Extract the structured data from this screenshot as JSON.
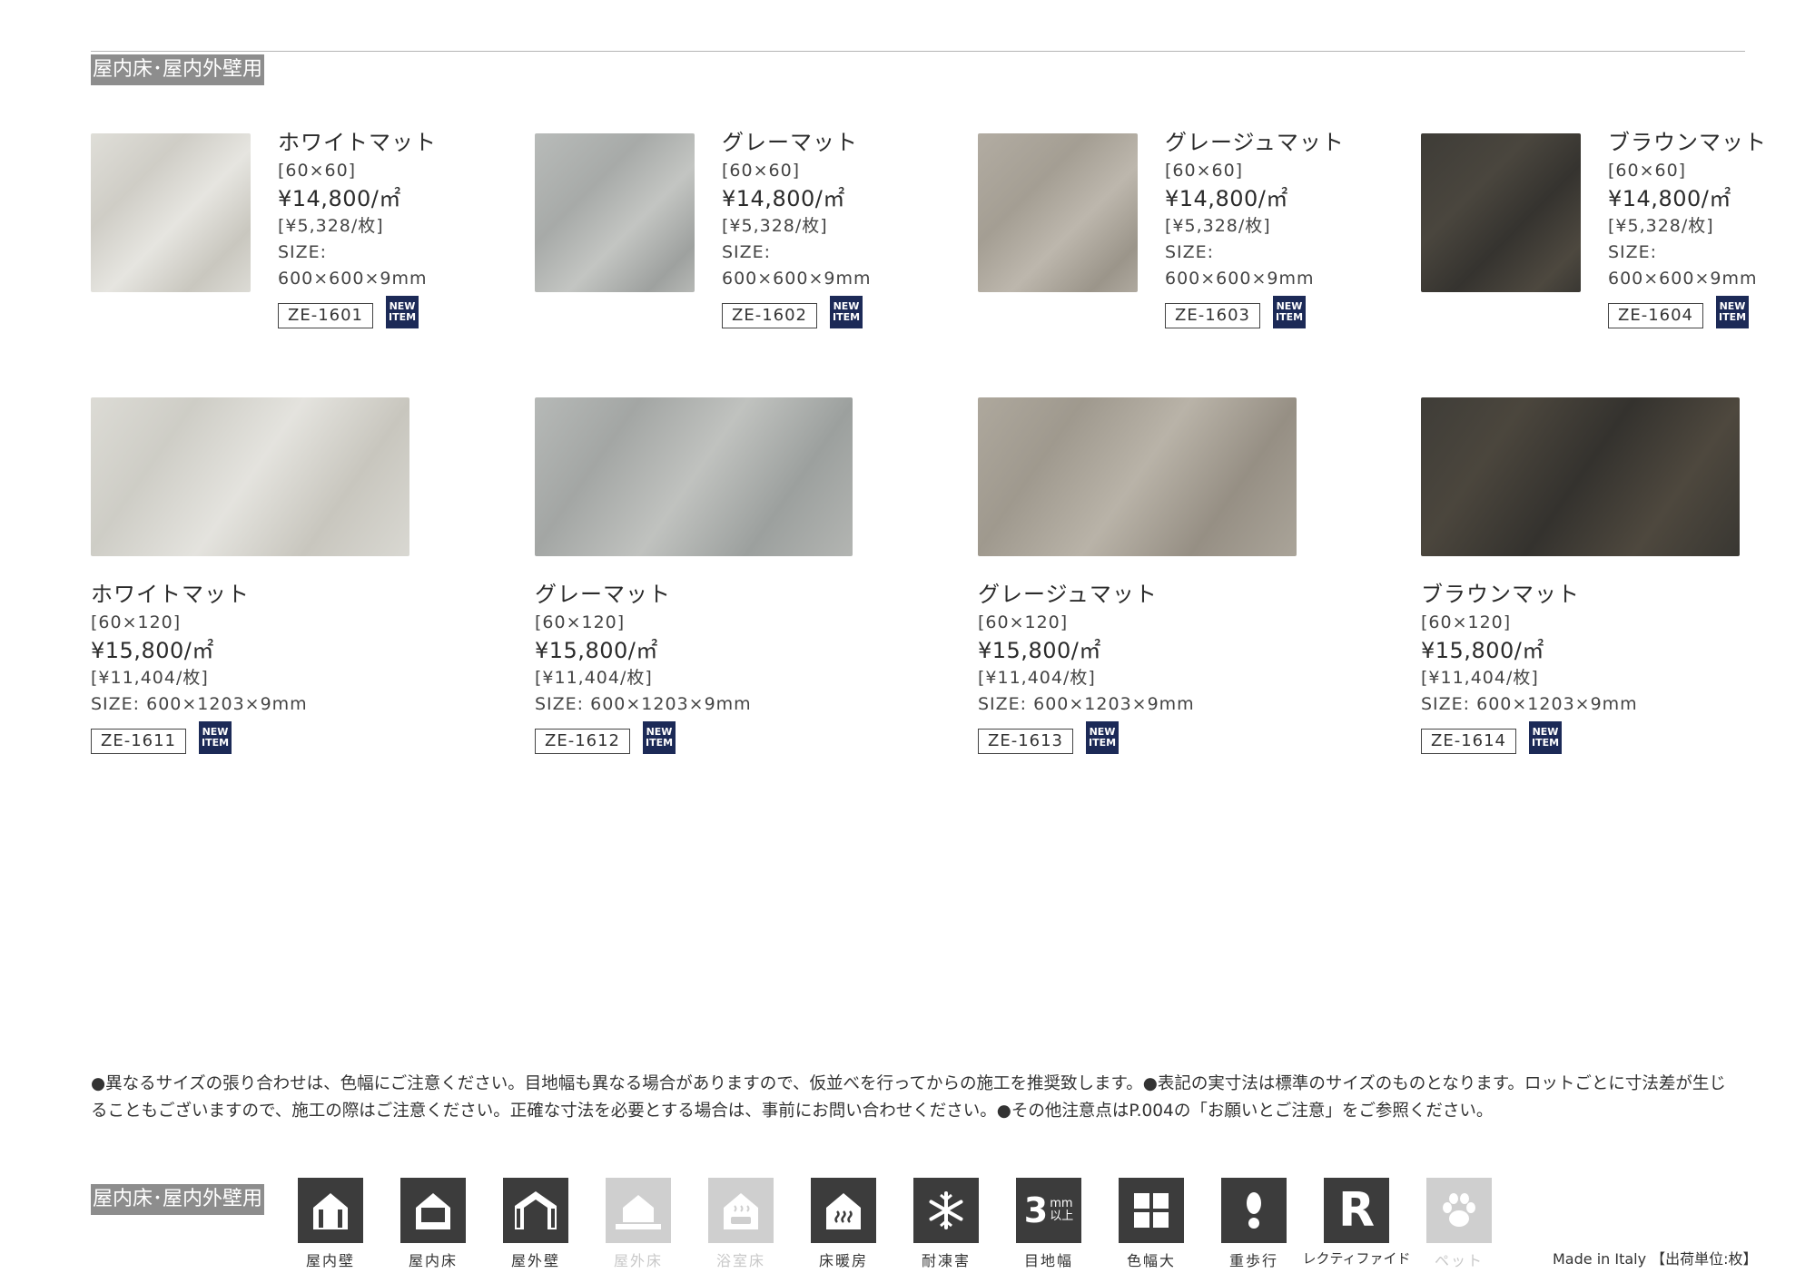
{
  "section_title": "屋内床･屋内外壁用",
  "row1": [
    {
      "name": "ホワイトマット",
      "size_label": "[60×60]",
      "price": "¥14,800/㎡",
      "per_piece": "[¥5,328/枚]",
      "size_title": "SIZE:",
      "size_value": "600×600×9mm",
      "code": "ZE-1601",
      "badge_line1": "NEW",
      "badge_line2": "ITEM"
    },
    {
      "name": "グレーマット",
      "size_label": "[60×60]",
      "price": "¥14,800/㎡",
      "per_piece": "[¥5,328/枚]",
      "size_title": "SIZE:",
      "size_value": "600×600×9mm",
      "code": "ZE-1602",
      "badge_line1": "NEW",
      "badge_line2": "ITEM"
    },
    {
      "name": "グレージュマット",
      "size_label": "[60×60]",
      "price": "¥14,800/㎡",
      "per_piece": "[¥5,328/枚]",
      "size_title": "SIZE:",
      "size_value": "600×600×9mm",
      "code": "ZE-1603",
      "badge_line1": "NEW",
      "badge_line2": "ITEM"
    },
    {
      "name": "ブラウンマット",
      "size_label": "[60×60]",
      "price": "¥14,800/㎡",
      "per_piece": "[¥5,328/枚]",
      "size_title": "SIZE:",
      "size_value": "600×600×9mm",
      "code": "ZE-1604",
      "badge_line1": "NEW",
      "badge_line2": "ITEM"
    }
  ],
  "row2": [
    {
      "name": "ホワイトマット",
      "size_label": "[60×120]",
      "price": "¥15,800/㎡",
      "per_piece": "[¥11,404/枚]",
      "size_full": "SIZE: 600×1203×9mm",
      "code": "ZE-1611",
      "badge_line1": "NEW",
      "badge_line2": "ITEM"
    },
    {
      "name": "グレーマット",
      "size_label": "[60×120]",
      "price": "¥15,800/㎡",
      "per_piece": "[¥11,404/枚]",
      "size_full": "SIZE: 600×1203×9mm",
      "code": "ZE-1612",
      "badge_line1": "NEW",
      "badge_line2": "ITEM"
    },
    {
      "name": "グレージュマット",
      "size_label": "[60×120]",
      "price": "¥15,800/㎡",
      "per_piece": "[¥11,404/枚]",
      "size_full": "SIZE: 600×1203×9mm",
      "code": "ZE-1613",
      "badge_line1": "NEW",
      "badge_line2": "ITEM"
    },
    {
      "name": "ブラウンマット",
      "size_label": "[60×120]",
      "price": "¥15,800/㎡",
      "per_piece": "[¥11,404/枚]",
      "size_full": "SIZE: 600×1203×9mm",
      "code": "ZE-1614",
      "badge_line1": "NEW",
      "badge_line2": "ITEM"
    }
  ],
  "notes": {
    "line1": "●異なるサイズの張り合わせは、色幅にご注意ください。目地幅も異なる場合がありますので、仮並べを行ってからの施工を推奨致します。●表記の実寸法は標準のサイズのものとなります。ロットごとに寸法差が生じ",
    "line2": "ることもございますので、施工の際はご注意ください。正確な寸法を必要とする場合は、事前にお問い合わせください。●その他注意点はP.004の「お願いとご注意」をご参照ください。"
  },
  "footer": {
    "section_title": "屋内床･屋内外壁用",
    "icons": [
      {
        "label": "屋内壁",
        "icon": "indoor-wall-icon",
        "active": true
      },
      {
        "label": "屋内床",
        "icon": "indoor-floor-icon",
        "active": true
      },
      {
        "label": "屋外壁",
        "icon": "outdoor-wall-icon",
        "active": true
      },
      {
        "label": "屋外床",
        "icon": "outdoor-floor-icon",
        "active": false
      },
      {
        "label": "浴室床",
        "icon": "bathroom-floor-icon",
        "active": false
      },
      {
        "label": "床暖房",
        "icon": "floor-heating-icon",
        "active": true
      },
      {
        "label": "耐凍害",
        "icon": "frost-resistance-icon",
        "active": true
      },
      {
        "label": "目地幅",
        "icon": "joint-width-icon",
        "active": true,
        "text_big": "3",
        "text_mm": "mm",
        "text_sub": "以上"
      },
      {
        "label": "色幅大",
        "icon": "color-variation-icon",
        "active": true
      },
      {
        "label": "重歩行",
        "icon": "heavy-traffic-icon",
        "active": true
      },
      {
        "label": "レクティファイド",
        "icon": "rectified-icon",
        "active": true,
        "text_big": "R"
      },
      {
        "label": "ペット",
        "icon": "pet-icon",
        "active": false
      }
    ],
    "made_in": "Made in Italy 【出荷単位:枚】"
  },
  "colors": {
    "badge": "#1c2a57",
    "tag_bg": "#8d8d8d",
    "icon_active": "#3c3c3c",
    "icon_inactive": "#cfcfcf"
  }
}
